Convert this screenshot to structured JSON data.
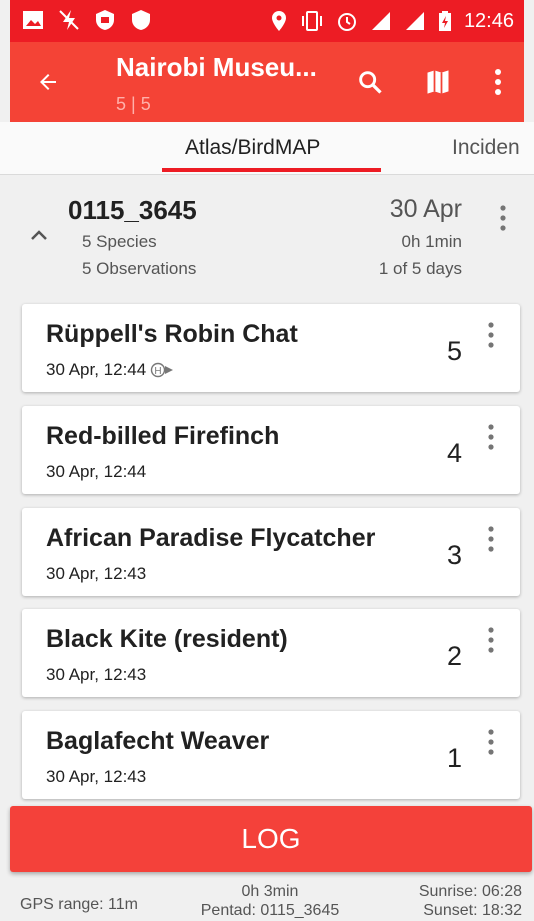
{
  "status_bar": {
    "time": "12:46",
    "left_icons": [
      "image-icon",
      "no-bolt-icon",
      "shield-icon",
      "shield-filled-icon"
    ],
    "right_icons": [
      "location-icon",
      "vibrate-icon",
      "alarm-icon",
      "signal-icon",
      "signal-icon",
      "battery-charging-icon"
    ]
  },
  "app_bar": {
    "title": "Nairobi Museu...",
    "subtitle": "5 | 5"
  },
  "tabs": [
    "Atlas/BirdMAP",
    "Inciden"
  ],
  "card_header": {
    "cell": "0115_3645",
    "date": "30 Apr",
    "species": "5 Species",
    "observations": "5 Observations",
    "duration": "0h 1min",
    "days": "1 of 5 days"
  },
  "observations": [
    {
      "name": "Rüppell's Robin Chat",
      "time": "30 Apr, 12:44",
      "count": "5",
      "badge": "H"
    },
    {
      "name": "Red-billed Firefinch",
      "time": "30 Apr, 12:44",
      "count": "4"
    },
    {
      "name": "African Paradise Flycatcher",
      "time": "30 Apr, 12:43",
      "count": "3"
    },
    {
      "name": "Black Kite (resident)",
      "time": "30 Apr, 12:43",
      "count": "2"
    },
    {
      "name": "Baglafecht Weaver",
      "time": "30 Apr, 12:43",
      "count": "1"
    }
  ],
  "log_button": "LOG",
  "footer": {
    "gps": "GPS range: 11m",
    "elapsed": "0h 3min",
    "pentad": "Pentad: 0115_3645",
    "sunrise": "Sunrise: 06:28",
    "sunset": "Sunset: 18:32"
  },
  "colors": {
    "status_bar": "#ed1c24",
    "app_bar": "#f44336",
    "accent": "#ed1c24",
    "log_button": "#f4413a"
  }
}
